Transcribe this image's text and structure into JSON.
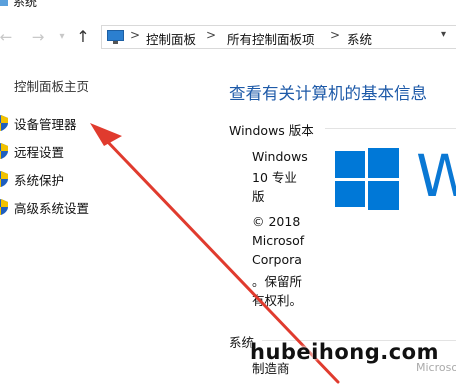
{
  "window": {
    "title": "系统"
  },
  "nav": {
    "back_icon": "back-arrow-icon",
    "forward_icon": "forward-arrow-icon",
    "recent_icon": "chevron-down-icon",
    "up_icon": "up-arrow-icon"
  },
  "address": {
    "icon": "control-panel-icon",
    "crumbs": [
      "控制面板",
      "所有控制面板项",
      "系统"
    ],
    "separator": ">"
  },
  "sidebar": {
    "home_link": "控制面板主页",
    "items": [
      {
        "label": "设备管理器",
        "icon": "shield-icon"
      },
      {
        "label": "远程设置",
        "icon": "shield-icon"
      },
      {
        "label": "系统保护",
        "icon": "shield-icon"
      },
      {
        "label": "高级系统设置",
        "icon": "shield-icon"
      }
    ]
  },
  "main": {
    "title": "查看有关计算机的基本信息",
    "edition_heading": "Windows 版本",
    "edition_lines": [
      "Windows",
      "10 专业",
      "版"
    ],
    "copyright_lines": [
      "© 2018",
      "Microsof",
      "Corpora",
      "。保留所",
      "有权利。"
    ],
    "logo_text": "W",
    "brand_crop": "Microso",
    "system_heading": "系统",
    "system_row_label": "制造商"
  },
  "watermark": "hubeihong.com",
  "colors": {
    "accent_blue": "#1e5aa8",
    "windows_blue": "#0078d7",
    "arrow_red": "#e03b2e"
  }
}
